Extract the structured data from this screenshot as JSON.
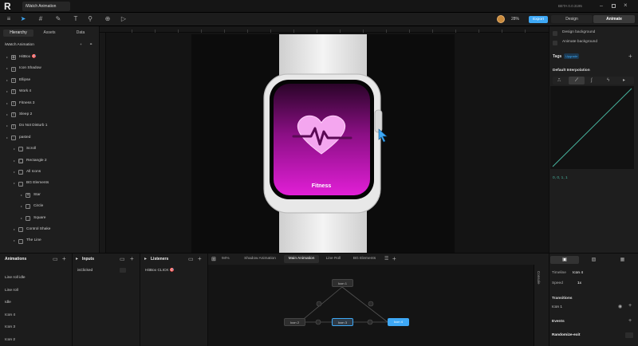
{
  "titlebar": {
    "app_logo": "R",
    "tab_title": "iWatch Animation",
    "version": "BETA 0.0.3195"
  },
  "toolbar": {
    "zoom": "28%",
    "export_label": "Export"
  },
  "left_panel": {
    "tabs": [
      "Hierarchy",
      "Assets",
      "Data"
    ],
    "artboard_name": "iWatch Animation",
    "tree": [
      {
        "label": "HitBox 🎯",
        "icon": "component-icon",
        "depth": 0
      },
      {
        "label": "Icon Shadow",
        "icon": "ellipse-icon",
        "depth": 0
      },
      {
        "label": "Ellipse",
        "icon": "ellipse-icon",
        "depth": 0
      },
      {
        "label": "Work 4",
        "icon": "text-icon",
        "depth": 0
      },
      {
        "label": "Fitness 3",
        "icon": "text-icon",
        "depth": 0
      },
      {
        "label": "Sleep 2",
        "icon": "text-icon",
        "depth": 0
      },
      {
        "label": "Do Not Disturb 1",
        "icon": "text-icon",
        "depth": 0
      },
      {
        "label": "pasted",
        "icon": "group-icon",
        "depth": 0
      },
      {
        "label": "Scroll",
        "icon": "group-icon",
        "depth": 1
      },
      {
        "label": "Rectangle 2",
        "icon": "rectangle-icon",
        "depth": 1
      },
      {
        "label": "All Icons",
        "icon": "group-icon",
        "depth": 1
      },
      {
        "label": "BG Elements",
        "icon": "group-icon",
        "depth": 1
      },
      {
        "label": "Star",
        "icon": "star-icon",
        "depth": 2
      },
      {
        "label": "Circle",
        "icon": "group-icon",
        "depth": 2
      },
      {
        "label": "Square",
        "icon": "group-icon",
        "depth": 2
      },
      {
        "label": "Control Shake",
        "icon": "group-icon",
        "depth": 1
      },
      {
        "label": "The Line",
        "icon": "group-icon",
        "depth": 1
      }
    ]
  },
  "canvas": {
    "watch_screen_label": "Fitness"
  },
  "right_panel": {
    "tabs": [
      "Design",
      "Animate"
    ],
    "design_background": "Design background",
    "animate_background": "Animate background",
    "tags_label": "Tags",
    "upgrade_badge": "Upgrade",
    "interpolation_label": "Default Interpolation",
    "curve_values": "0, 0, 1, 1",
    "timeline_label": "Timeline",
    "timeline_value": "Icon 4",
    "speed_label": "Speed",
    "speed_value": "1x",
    "transitions_label": "Transitions",
    "transition_item": "Icon 1",
    "events_label": "Events",
    "event_item": "Randomize-exit"
  },
  "bottom": {
    "animations_header": "Animations",
    "animations": [
      "Line roll idle",
      "Line roll",
      "Idle",
      "Icon 4",
      "Icon 3",
      "Icon 2"
    ],
    "inputs_header": "Inputs",
    "inputs": [
      "isClicked"
    ],
    "listeners_header": "Listeners",
    "listeners": [
      "HitBox CLICK 🎯"
    ],
    "sm_zoom": "94%",
    "sm_tabs": [
      "Shadow Animation",
      "Main Animation",
      "Line Roll",
      "BG Elements"
    ],
    "side_label": "Console",
    "nodes": {
      "top": "Icon 1",
      "left": "Icon 2",
      "center": "Icon 3",
      "right": "Icon 4"
    }
  },
  "colors": {
    "accent": "#3ea8f5",
    "watch_screen": "#d61ccc"
  }
}
